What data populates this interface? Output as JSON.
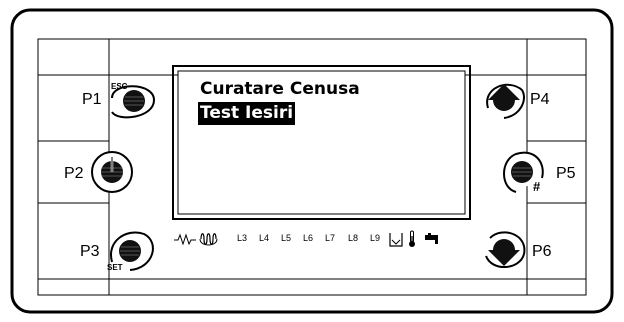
{
  "buttons": {
    "p1": {
      "label": "P1",
      "sublabel": "ESC",
      "icon": "dot-icon"
    },
    "p2": {
      "label": "P2",
      "sublabel": "",
      "icon": "power-icon"
    },
    "p3": {
      "label": "P3",
      "sublabel": "SET",
      "icon": "dot-icon"
    },
    "p4": {
      "label": "P4",
      "sublabel": "",
      "icon": "arrow-up-icon"
    },
    "p5": {
      "label": "P5",
      "sublabel": "#",
      "icon": "dot-icon"
    },
    "p6": {
      "label": "P6",
      "sublabel": "",
      "icon": "arrow-down-icon"
    }
  },
  "display": {
    "lines": [
      {
        "text": "Curatare Cenusa",
        "selected": false
      },
      {
        "text": "Test Iesiri",
        "selected": true
      }
    ]
  },
  "indicators": {
    "labels": [
      "L3",
      "L4",
      "L5",
      "L6",
      "L7",
      "L8",
      "L9"
    ],
    "icons": [
      "resistor-icon",
      "coil-icon",
      "ash-tray-icon",
      "thermometer-icon",
      "tap-icon"
    ]
  },
  "colors": {
    "ink": "#000000",
    "background": "#ffffff"
  }
}
